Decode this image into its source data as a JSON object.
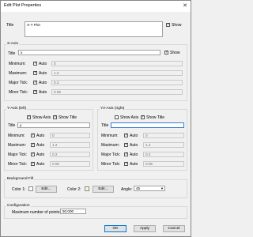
{
  "window": {
    "title": "Edit Plot Properties",
    "close": "✕"
  },
  "main": {
    "title_label": "Title",
    "title_value": "X-Y Plot",
    "show_label": "Show"
  },
  "x_axis": {
    "group": "X-Axis",
    "title_label": "Title",
    "title_value": "x",
    "show_label": "Show",
    "rows": [
      {
        "label": "Minimum:",
        "auto": "Auto",
        "value": "0"
      },
      {
        "label": "Maximum:",
        "auto": "Auto",
        "value": "1.2"
      },
      {
        "label": "Major Tick:",
        "auto": "Auto",
        "value": "0.2"
      },
      {
        "label": "Minor Tick:",
        "auto": "Auto",
        "value": "0.05"
      }
    ]
  },
  "y1_axis": {
    "group": "Y-Axis (left)",
    "show_axis": "Show Axis",
    "show_title": "Show Title",
    "title_label": "Title",
    "title_value": "y",
    "rows": [
      {
        "label": "Minimum:",
        "auto": "Auto",
        "value": "0"
      },
      {
        "label": "Maximum:",
        "auto": "Auto",
        "value": "1.2"
      },
      {
        "label": "Major Tick:",
        "auto": "Auto",
        "value": "0.2"
      },
      {
        "label": "Minor Tick:",
        "auto": "Auto",
        "value": "0.05"
      }
    ]
  },
  "y2_axis": {
    "group": "Y2-Axis (right)",
    "show_axis": "Show Axis",
    "show_title": "Show Title",
    "title_label": "Title",
    "title_value": "",
    "rows": [
      {
        "label": "Minimum:",
        "auto": "Auto",
        "value": "0"
      },
      {
        "label": "Maximum:",
        "auto": "Auto",
        "value": "1.2"
      },
      {
        "label": "Major Tick:",
        "auto": "Auto",
        "value": "0.2"
      },
      {
        "label": "Minor Tick:",
        "auto": "Auto",
        "value": "0.05"
      }
    ]
  },
  "background": {
    "group": "Background Fill",
    "color1_label": "Color 1:",
    "color2_label": "Color 2:",
    "edit_label": "Edit...",
    "angle_label": "Angle:",
    "angle_value": "45",
    "color1": "#ffffff",
    "color2": "#fff6d5"
  },
  "configuration": {
    "group": "Configuration",
    "max_points_label": "Maximum number of points:",
    "max_points_value": "50,000"
  },
  "buttons": {
    "ok": "OK",
    "apply": "Apply",
    "cancel": "Cancel"
  },
  "icons": {
    "check": "✓",
    "dropdown": "▼"
  }
}
